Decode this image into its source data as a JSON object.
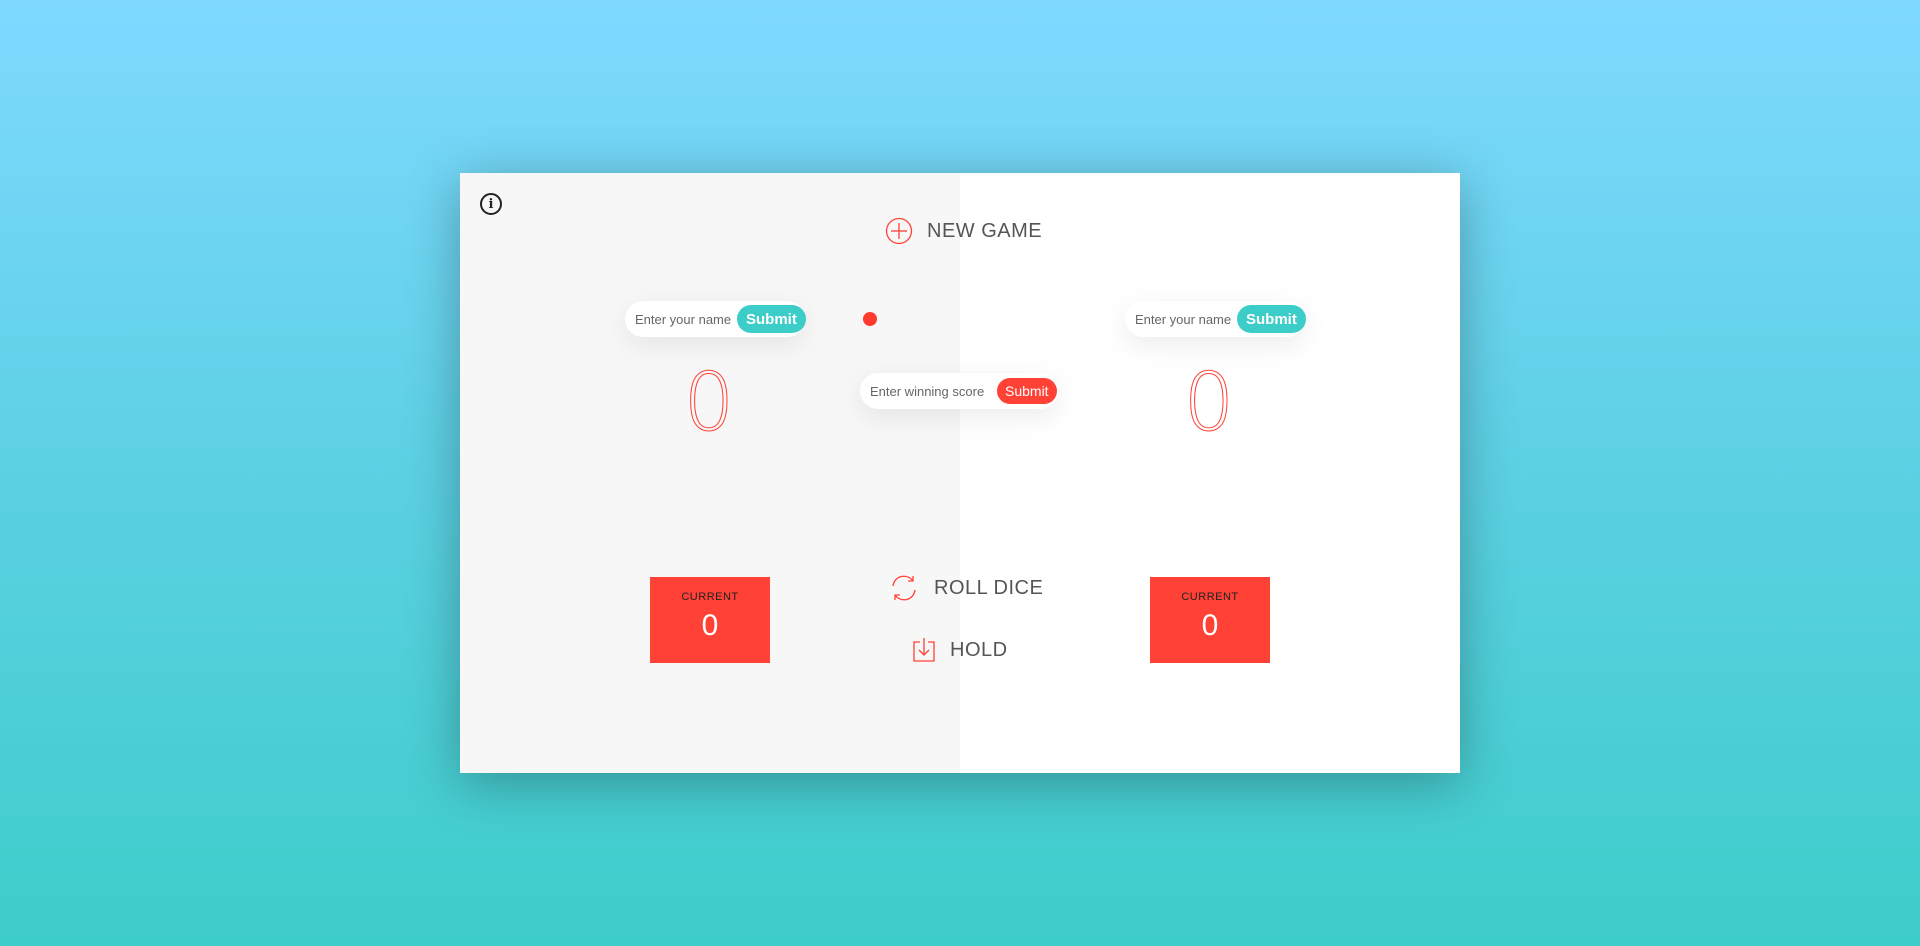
{
  "colors": {
    "accent": "#ff4136",
    "teal": "#3dcdc9",
    "panel_left": "#f7f7f7",
    "panel_right": "#ffffff",
    "background_top": "#7fd9ff",
    "background_bottom": "#3dcdc9"
  },
  "icons": {
    "info": "info-icon",
    "new_game": "plus-circle-icon",
    "roll_dice": "refresh-icon",
    "hold": "download-icon"
  },
  "controls": {
    "new_game_label": "NEW GAME",
    "roll_dice_label": "ROLL DICE",
    "hold_label": "HOLD"
  },
  "players": [
    {
      "name_placeholder": "Enter your name",
      "submit_label": "Submit",
      "score": "0",
      "current_label": "CURRENT",
      "current_score": "0",
      "active": true
    },
    {
      "name_placeholder": "Enter your name",
      "submit_label": "Submit",
      "score": "0",
      "current_label": "CURRENT",
      "current_score": "0",
      "active": false
    }
  ],
  "winning_score": {
    "placeholder": "Enter winning score",
    "submit_label": "Submit"
  }
}
